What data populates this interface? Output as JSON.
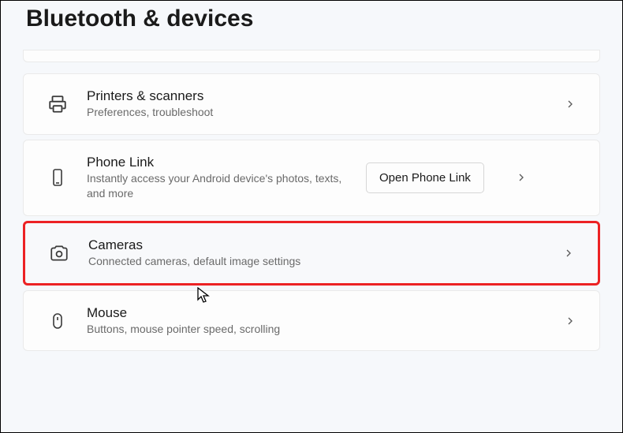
{
  "header": {
    "title": "Bluetooth & devices"
  },
  "items": [
    {
      "id": "printers",
      "title": "Printers & scanners",
      "subtitle": "Preferences, troubleshoot"
    },
    {
      "id": "phone-link",
      "title": "Phone Link",
      "subtitle": "Instantly access your Android device's photos, texts, and more",
      "action_label": "Open Phone Link"
    },
    {
      "id": "cameras",
      "title": "Cameras",
      "subtitle": "Connected cameras, default image settings",
      "highlighted": true
    },
    {
      "id": "mouse",
      "title": "Mouse",
      "subtitle": "Buttons, mouse pointer speed, scrolling"
    }
  ]
}
